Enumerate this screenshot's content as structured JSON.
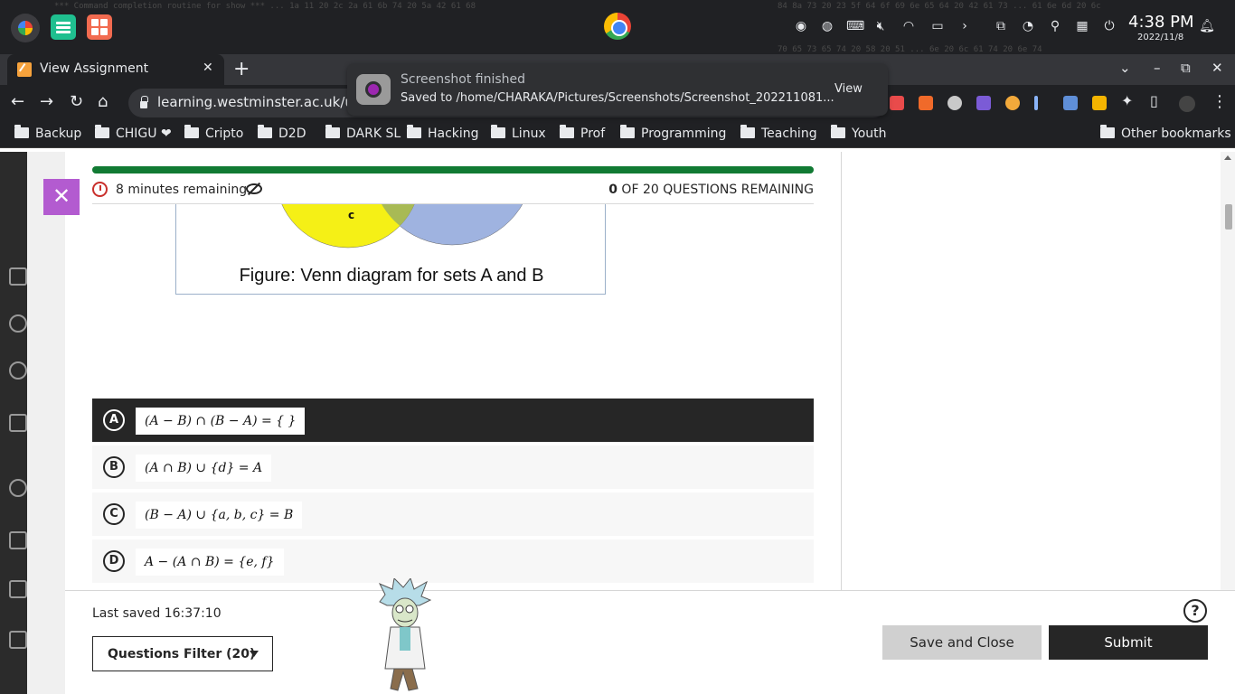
{
  "os_shelf": {
    "time": "4:38 PM",
    "date": "2022/11/8"
  },
  "browser": {
    "tab_title": "View Assignment",
    "url": "learning.westminster.ac.uk/ultr",
    "bookmarks": [
      "Backup",
      "CHIGU ❤",
      "Cripto",
      "D2D",
      "DARK SL",
      "Hacking",
      "Linux",
      "Prof",
      "Programming",
      "Teaching",
      "Youth"
    ],
    "other_bookmarks": "Other bookmarks"
  },
  "notification": {
    "title": "Screenshot finished",
    "body": "Saved to /home/CHARAKA/Pictures/Screenshots/Screenshot_202211081...",
    "action": "View"
  },
  "assessment": {
    "time_remaining": "8 minutes remaining",
    "questions_remaining_count": "0",
    "questions_remaining_label": "OF 20 QUESTIONS REMAINING",
    "progress_fraction": 1.0,
    "figure_caption": "Figure: Venn diagram for sets A and B",
    "figure_label_c": "c",
    "options": [
      {
        "letter": "A",
        "text": "(A − B)  ∩  (B − A) = { }",
        "selected": true
      },
      {
        "letter": "B",
        "text": "(A  ∩  B)  ∪  {d} = A",
        "selected": false
      },
      {
        "letter": "C",
        "text": "(B −  A)  ∪  {a, b, c} = B",
        "selected": false
      },
      {
        "letter": "D",
        "text": "A − (A  ∩  B)  =  {e, f}",
        "selected": false
      }
    ]
  },
  "footer": {
    "last_saved": "Last saved 16:37:10",
    "questions_filter": "Questions Filter (20)",
    "help": "?",
    "save_close": "Save and Close",
    "submit": "Submit"
  },
  "colors": {
    "progress": "#117a33",
    "close_panel": "#b35bd0",
    "selected_option": "#262626",
    "venn_yellow": "#f5f016",
    "venn_blue": "#9fb3e0",
    "venn_overlap": "#a8ba55"
  }
}
